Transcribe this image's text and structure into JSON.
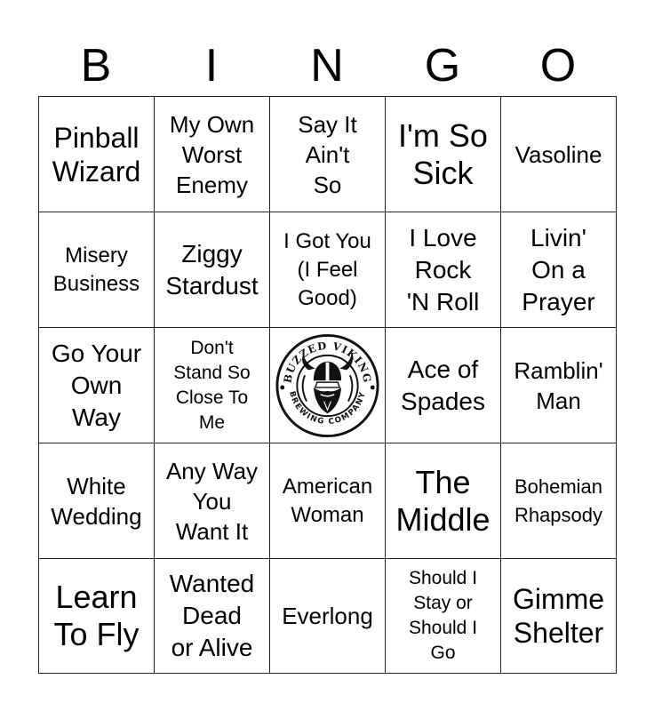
{
  "header": {
    "letters": [
      "B",
      "I",
      "N",
      "G",
      "O"
    ]
  },
  "board": {
    "cells": [
      {
        "text": "Pinball\nWizard",
        "size": "s-l"
      },
      {
        "text": "My Own\nWorst\nEnemy",
        "size": "s-ms"
      },
      {
        "text": "Say It\nAin't\nSo",
        "size": "s-ms"
      },
      {
        "text": "I'm So\nSick",
        "size": "s-xl"
      },
      {
        "text": "Vasoline",
        "size": "s-ms"
      },
      {
        "text": "Misery\nBusiness",
        "size": "s-s"
      },
      {
        "text": "Ziggy\nStardust",
        "size": "s-m"
      },
      {
        "text": "I Got You\n(I Feel\nGood)",
        "size": "s-s"
      },
      {
        "text": "I Love\nRock\n'N Roll",
        "size": "s-m"
      },
      {
        "text": "Livin'\nOn a\nPrayer",
        "size": "s-m"
      },
      {
        "text": "Go Your\nOwn\nWay",
        "size": "s-m"
      },
      {
        "text": "Don't\nStand So\nClose To\nMe",
        "size": "s-xxs"
      },
      {
        "free": true,
        "logo": {
          "top_text": "BUZZED VIKING",
          "bottom_text": "BREWING COMPANY",
          "icon": "viking-head-icon"
        }
      },
      {
        "text": "Ace of\nSpades",
        "size": "s-m"
      },
      {
        "text": "Ramblin'\nMan",
        "size": "s-ms"
      },
      {
        "text": "White\nWedding",
        "size": "s-ms"
      },
      {
        "text": "Any Way\nYou\nWant It",
        "size": "s-ms"
      },
      {
        "text": "American\nWoman",
        "size": "s-s"
      },
      {
        "text": "The\nMiddle",
        "size": "s-xl"
      },
      {
        "text": "Bohemian\nRhapsody",
        "size": "s-xs"
      },
      {
        "text": "Learn\nTo Fly",
        "size": "s-xl"
      },
      {
        "text": "Wanted\nDead\nor Alive",
        "size": "s-m"
      },
      {
        "text": "Everlong",
        "size": "s-ms"
      },
      {
        "text": "Should I\nStay or\nShould I\nGo",
        "size": "s-xxs"
      },
      {
        "text": "Gimme\nShelter",
        "size": "s-l"
      }
    ]
  }
}
